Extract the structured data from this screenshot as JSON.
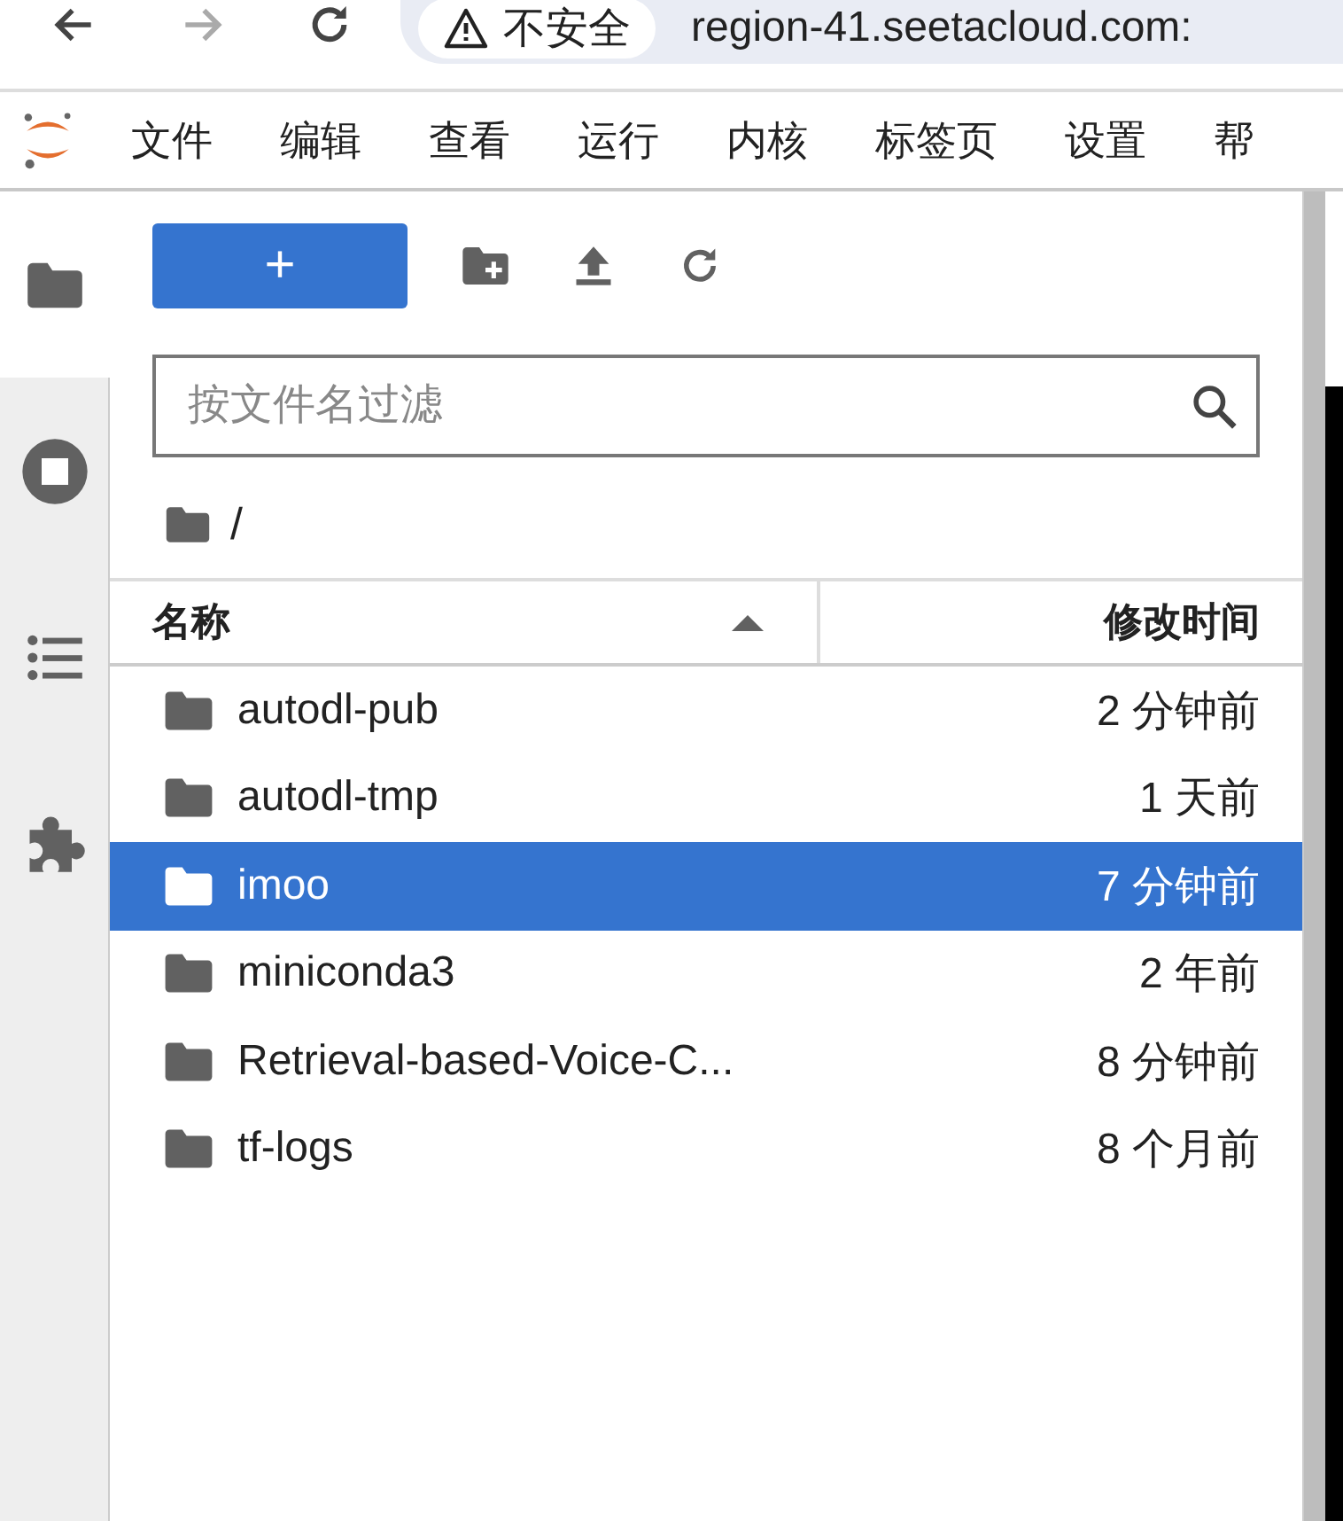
{
  "browser": {
    "back_disabled": false,
    "forward_disabled": true,
    "security": "不安全",
    "url": "region-41.seetacloud.com:"
  },
  "menu": [
    "文件",
    "编辑",
    "查看",
    "运行",
    "内核",
    "标签页",
    "设置",
    "帮"
  ],
  "sidebar": [
    {
      "kind": "folder",
      "selected": true
    },
    {
      "kind": "stop",
      "selected": false
    },
    {
      "kind": "list",
      "selected": false
    },
    {
      "kind": "puzzle",
      "selected": false
    }
  ],
  "toolbar": {
    "new_label": "+"
  },
  "filter": {
    "placeholder": "按文件名过滤"
  },
  "breadcrumb": "/",
  "table": {
    "columns": [
      {
        "label": "名称",
        "sorted": true
      },
      {
        "label": "修改时间",
        "sorted": false
      }
    ],
    "rows": [
      {
        "name": "autodl-pub",
        "modified": "2 分钟前",
        "selected": false
      },
      {
        "name": "autodl-tmp",
        "modified": "1 天前",
        "selected": false
      },
      {
        "name": "imoo",
        "modified": "7 分钟前",
        "selected": true
      },
      {
        "name": "miniconda3",
        "modified": "2 年前",
        "selected": false
      },
      {
        "name": "Retrieval-based-Voice-C...",
        "modified": "8 分钟前",
        "selected": false
      },
      {
        "name": "tf-logs",
        "modified": "8 个月前",
        "selected": false
      }
    ]
  }
}
